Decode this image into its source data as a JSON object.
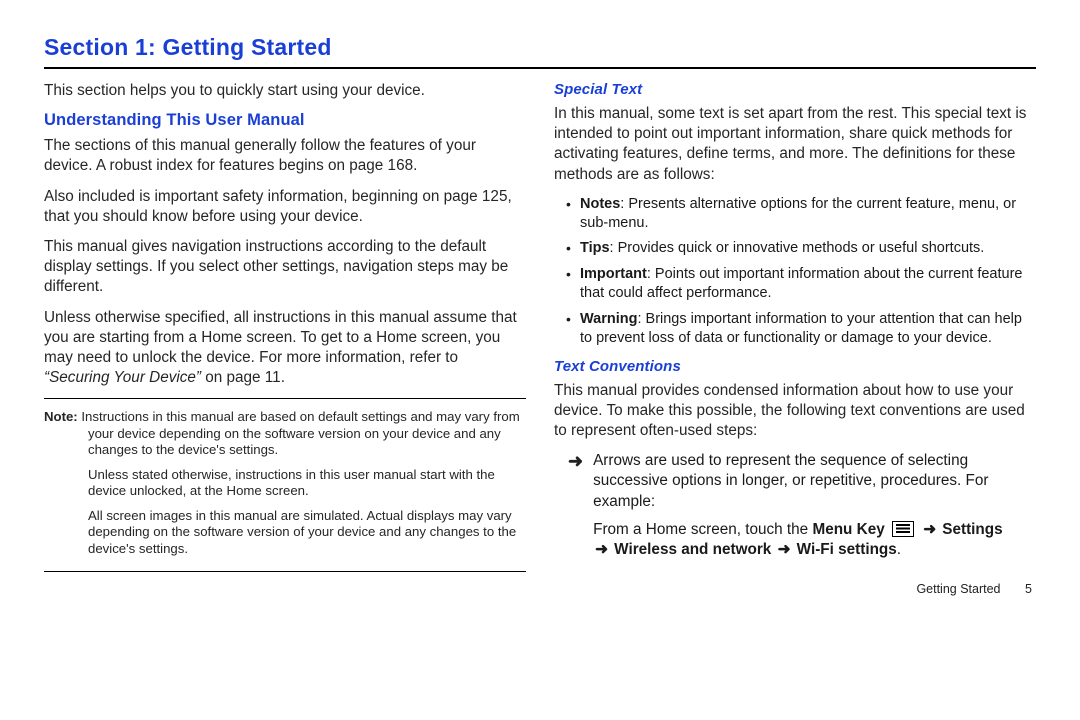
{
  "heading": "Section 1: Getting Started",
  "left": {
    "intro": "This section helps you to quickly start using your device.",
    "h2": "Understanding This User Manual",
    "p1": "The sections of this manual generally follow the features of your device. A robust index for features begins on page 168.",
    "p2": "Also included is important safety information, beginning on page 125, that you should know before using your device.",
    "p3": "This manual gives navigation instructions according to the default display settings. If you select other settings, navigation steps may be different.",
    "p4a": "Unless otherwise specified, all instructions in this manual assume that you are starting from a Home screen. To get to a Home screen, you may need to unlock the device. For more information, refer to ",
    "p4quote": "“Securing Your Device”",
    "p4b": "  on page 11.",
    "note": {
      "label": "Note:",
      "n1": " Instructions in this manual are based on default settings and may vary from your device depending on the software version on your device and any changes to the device's settings.",
      "n2": "Unless stated otherwise, instructions in this user manual start with the device unlocked, at the Home screen.",
      "n3": "All screen images in this manual are simulated. Actual displays may vary depending on the software version of your device and any changes to the device's settings."
    }
  },
  "right": {
    "h3a": "Special Text",
    "sp": "In this manual, some text is set apart from the rest. This special text is intended to point out important information, share quick methods for activating features, define terms, and more. The definitions for these methods are as follows:",
    "defs": {
      "notes_l": "Notes",
      "notes_t": ": Presents alternative options for the current feature, menu, or sub-menu.",
      "tips_l": "Tips",
      "tips_t": ": Provides quick or innovative methods or useful shortcuts.",
      "imp_l": "Important",
      "imp_t": ": Points out important information about the current feature that could affect performance.",
      "warn_l": "Warning",
      "warn_t": ": Brings important information to your attention that can help to prevent loss of data or functionality or damage to your device."
    },
    "h3b": "Text Conventions",
    "tc": "This manual provides condensed information about how to use your device. To make this possible, the following text conventions are used to represent often-used steps:",
    "arrow_desc": "Arrows are used to represent the sequence of selecting successive options in longer, or repetitive, procedures. For example:",
    "example_pre": "From a Home screen, touch the ",
    "mk": "Menu Key",
    "arrow": "➜",
    "settings": "Settings",
    "wn": "Wireless and network",
    "wf": "Wi-Fi settings",
    "period": "."
  },
  "footer": {
    "label": "Getting Started",
    "page": "5"
  }
}
